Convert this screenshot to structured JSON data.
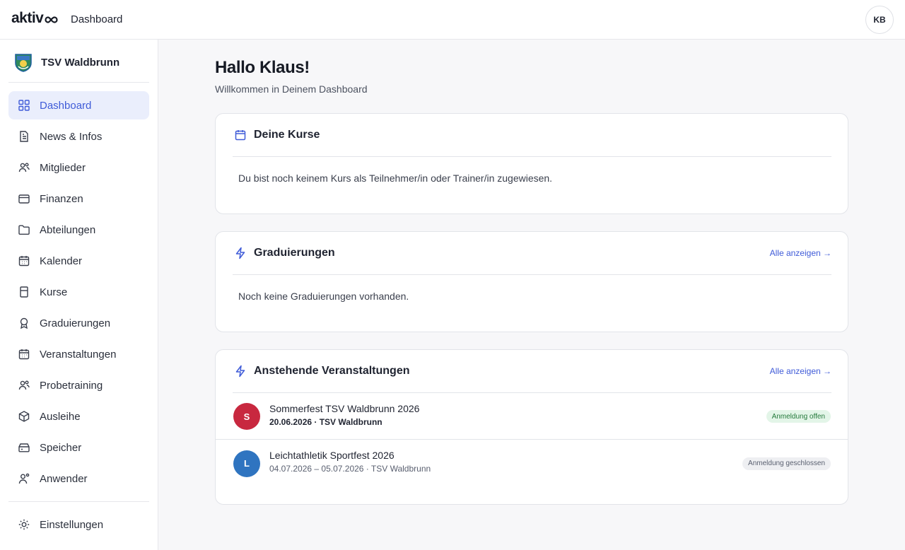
{
  "app": {
    "logo_text": "aktiv",
    "page_title": "Dashboard",
    "user_initials": "KB"
  },
  "club": {
    "name": "TSV Waldbrunn"
  },
  "sidebar": {
    "items": [
      {
        "label": "Dashboard",
        "icon": "grid-icon",
        "active": true
      },
      {
        "label": "News & Infos",
        "icon": "document-icon"
      },
      {
        "label": "Mitglieder",
        "icon": "users-icon"
      },
      {
        "label": "Finanzen",
        "icon": "wallet-icon"
      },
      {
        "label": "Abteilungen",
        "icon": "folder-icon"
      },
      {
        "label": "Kalender",
        "icon": "calendar-icon"
      },
      {
        "label": "Kurse",
        "icon": "course-icon"
      },
      {
        "label": "Graduierungen",
        "icon": "award-icon"
      },
      {
        "label": "Veranstaltungen",
        "icon": "calendar-icon"
      },
      {
        "label": "Probetraining",
        "icon": "users-icon"
      },
      {
        "label": "Ausleihe",
        "icon": "box-icon"
      },
      {
        "label": "Speicher",
        "icon": "storage-icon"
      },
      {
        "label": "Anwender",
        "icon": "user-settings-icon"
      }
    ],
    "settings_label": "Einstellungen"
  },
  "main": {
    "greeting": "Hallo Klaus!",
    "subtitle": "Willkommen in Deinem Dashboard",
    "courses": {
      "title": "Deine Kurse",
      "empty": "Du bist noch keinem Kurs als Teilnehmer/in oder Trainer/in zugewiesen."
    },
    "graduations": {
      "title": "Graduierungen",
      "link": "Alle anzeigen →",
      "empty": "Noch keine Graduierungen vorhanden."
    },
    "events": {
      "title": "Anstehende Veranstaltungen",
      "link": "Alle anzeigen →",
      "items": [
        {
          "initial": "S",
          "title": "Sommerfest TSV Waldbrunn 2026",
          "meta": "20.06.2026 · TSV Waldbrunn",
          "status": "Anmeldung offen",
          "color": "#c8283f"
        },
        {
          "initial": "L",
          "title": "Leichtathletik Sportfest 2026",
          "meta": "04.07.2026 – 05.07.2026 · TSV Waldbrunn",
          "status": "Anmeldung geschlossen",
          "color": "#2f74c0"
        }
      ]
    }
  },
  "colors": {
    "accent": "#3f5bd8",
    "active_bg": "#eaeefc",
    "badge_open_bg": "#e3f5e8",
    "badge_open_text": "#257a3c"
  }
}
